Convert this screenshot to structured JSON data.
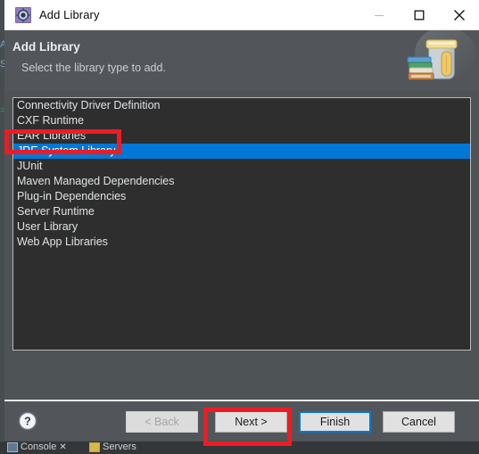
{
  "ide_backdrop": {
    "ghost_text_top": "A",
    "ghost_text_mid": "S",
    "ghost_green": "=",
    "tabs": [
      {
        "label": "Console",
        "icon": "console-icon",
        "closable": true
      },
      {
        "label": "Servers",
        "icon": "server-icon",
        "closable": false
      }
    ],
    "close_glyph": "✕"
  },
  "window": {
    "title": "Add Library",
    "icon": "add-library-gear-icon",
    "controls": {
      "minimize": {
        "name": "minimize-button",
        "glyph": "—",
        "enabled": false
      },
      "maximize": {
        "name": "maximize-button",
        "glyph": "□",
        "enabled": true
      },
      "close": {
        "name": "close-button",
        "glyph": "✕",
        "enabled": true
      }
    }
  },
  "header": {
    "title": "Add Library",
    "subtitle": "Select the library type to add.",
    "art_icon": "jar-with-books-icon"
  },
  "library_list": {
    "name": "library-type-list",
    "selected_index": 3,
    "items": [
      "Connectivity Driver Definition",
      "CXF Runtime",
      "EAR Libraries",
      "JRE System Library",
      "JUnit",
      "Maven Managed Dependencies",
      "Plug-in Dependencies",
      "Server Runtime",
      "User Library",
      "Web App Libraries"
    ]
  },
  "footer": {
    "help_icon": "help-question-icon",
    "buttons": [
      {
        "id": "back",
        "label": "< Back",
        "enabled": false,
        "focused": false
      },
      {
        "id": "next",
        "label": "Next >",
        "enabled": true,
        "focused": false
      },
      {
        "id": "finish",
        "label": "Finish",
        "enabled": true,
        "focused": true
      },
      {
        "id": "cancel",
        "label": "Cancel",
        "enabled": true,
        "focused": false
      }
    ]
  },
  "annotations": {
    "highlight_color": "#ed1c24",
    "boxes": [
      {
        "target": "JRE System Library",
        "name": "annotation-box-jre-system-library"
      },
      {
        "target": "Next >",
        "name": "annotation-box-next-button"
      }
    ]
  },
  "colors": {
    "selection_blue": "#0078d7",
    "list_background": "#2e2e2e",
    "dialog_background": "#52565a",
    "titlebar_background": "#ffffff",
    "annotation_red": "#ed1c24"
  }
}
